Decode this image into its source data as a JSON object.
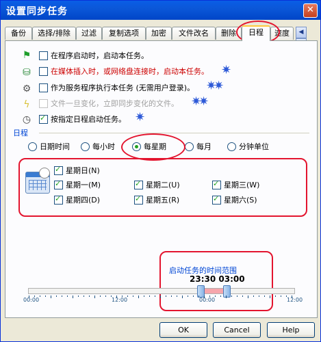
{
  "window": {
    "title": "设置同步任务",
    "close_label": "✕"
  },
  "tabs": [
    "备份",
    "选择/排除",
    "过滤",
    "复制选项",
    "加密",
    "文件改名",
    "删除",
    "日程",
    "速度"
  ],
  "options": [
    {
      "label": "在程序启动时，启动本任务。",
      "checked": false,
      "icon": "green-flag-icon"
    },
    {
      "label": "在媒体插入时，或网络盘连接时，启动本任务。",
      "checked": false,
      "icon": "network-drive-icon",
      "color": "#cc0000"
    },
    {
      "label": "作为服务程序执行本任务 (无需用户登录)。",
      "checked": false,
      "icon": "gear-icon"
    },
    {
      "label": "文件一旦变化，立即同步变化的文件。",
      "checked": false,
      "icon": "lightning-icon",
      "disabled": true
    },
    {
      "label": "按指定日程启动任务。",
      "checked": true,
      "icon": "clock-icon"
    }
  ],
  "schedule": {
    "group_label": "日程",
    "radios": [
      "日期时间",
      "每小时",
      "每星期",
      "每月",
      "分钟单位"
    ],
    "selected": "每星期",
    "days": [
      {
        "label": "星期日(N)",
        "checked": true
      },
      {
        "label": "星期一(M)",
        "checked": true
      },
      {
        "label": "星期二(U)",
        "checked": true
      },
      {
        "label": "星期三(W)",
        "checked": true
      },
      {
        "label": "星期四(D)",
        "checked": true
      },
      {
        "label": "星期五(R)",
        "checked": true
      },
      {
        "label": "星期六(S)",
        "checked": true
      }
    ]
  },
  "range": {
    "title": "启动任务的时间范围",
    "start": "23:30",
    "end": "03:00",
    "ticks": [
      "00:00",
      "12:00",
      "00:00",
      "12:00"
    ]
  },
  "buttons": {
    "ok": "OK",
    "cancel": "Cancel",
    "help": "Help"
  }
}
